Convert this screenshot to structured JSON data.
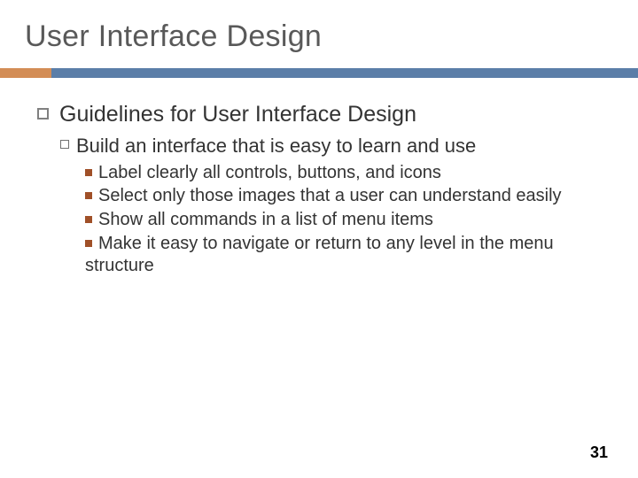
{
  "title": "User Interface Design",
  "level1": "Guidelines for User Interface Design",
  "level2": "Build an interface that is easy to learn and use",
  "bullets": {
    "b0": "Label clearly all controls, buttons, and icons",
    "b1": "Select only those images that a user can understand easily",
    "b2": "Show all commands in a list of menu items",
    "b3": "Make it easy to navigate or return to any level in the menu structure"
  },
  "page_number": "31"
}
